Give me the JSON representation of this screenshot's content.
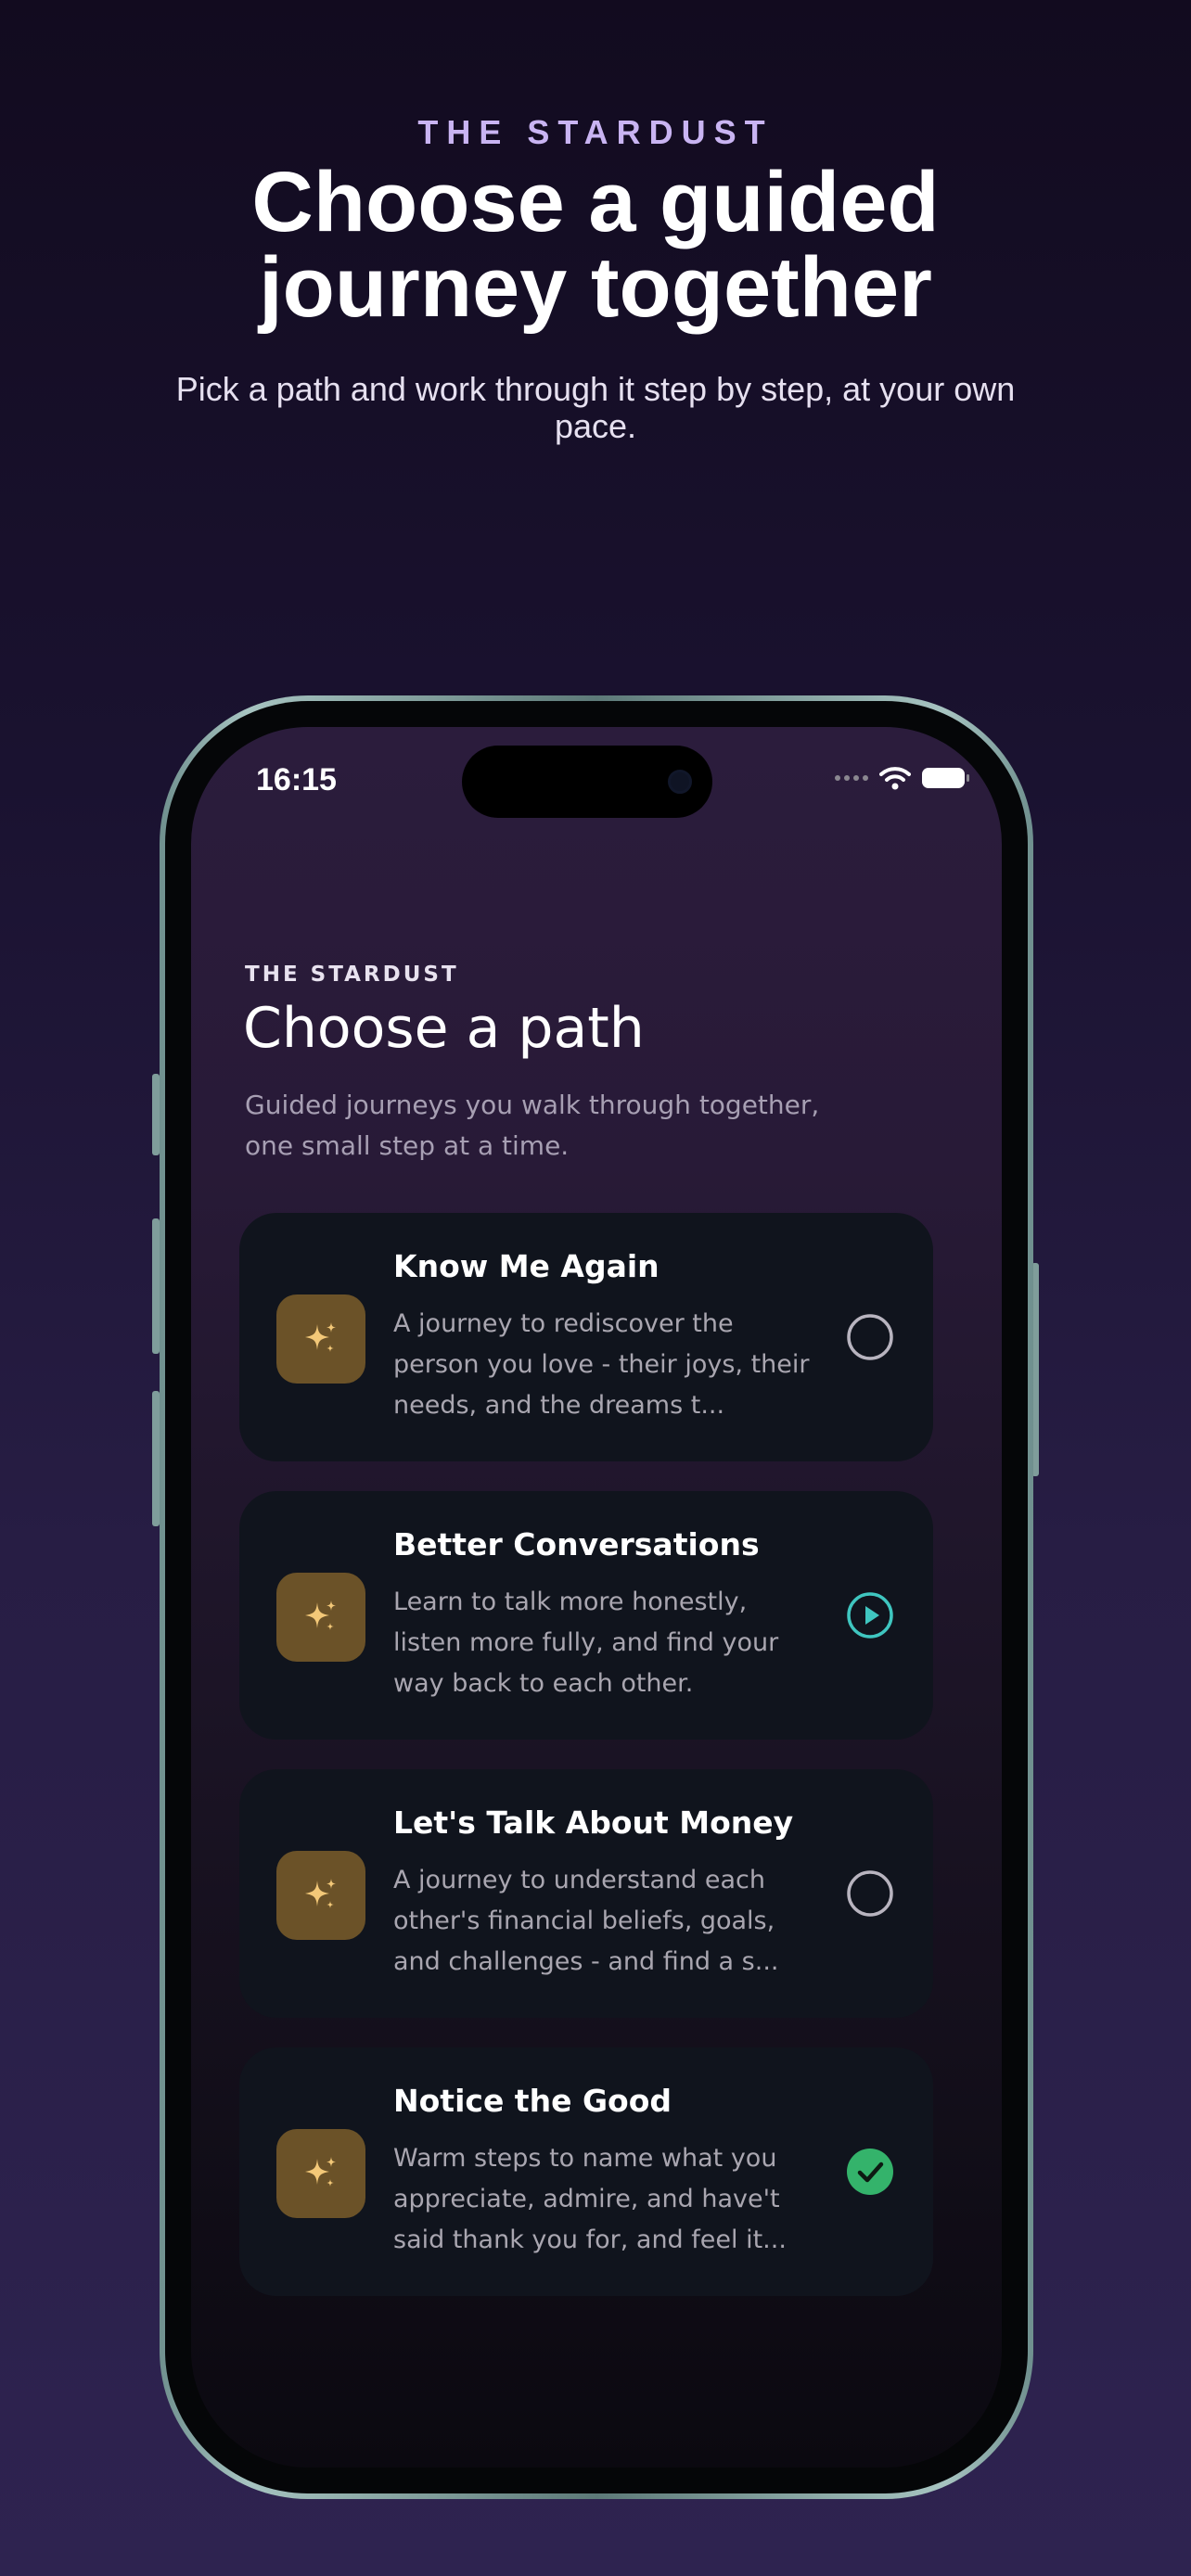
{
  "hero": {
    "eyebrow": "THE STARDUST",
    "title": "Choose a guided journey together",
    "subtitle": "Pick a path and work through it step by step, at your own pace."
  },
  "status_bar": {
    "time": "16:15"
  },
  "screen": {
    "eyebrow": "THE STARDUST",
    "title": "Choose a path",
    "subtitle": "Guided journeys you walk through together, one small step at a time."
  },
  "paths": [
    {
      "title": "Know Me Again",
      "description": "A journey to rediscover the person you love - their joys, their needs, and the dreams t...",
      "icon": "sparkle-icon",
      "state": "not-started"
    },
    {
      "title": "Better Conversations",
      "description": "Learn to talk more honestly, listen more fully, and find your way back to each other.",
      "icon": "sparkle-icon",
      "state": "in-progress"
    },
    {
      "title": "Let's Talk About Money",
      "description": "A journey to understand each other's financial beliefs, goals, and challenges - and find a s...",
      "icon": "sparkle-icon",
      "state": "not-started"
    },
    {
      "title": "Notice the Good",
      "description": "Warm steps to name what you appreciate, admire, and have't said thank you for, and feel it...",
      "icon": "sparkle-icon",
      "state": "completed"
    }
  ],
  "colors": {
    "accent_progress": "#3fc6c0",
    "accent_completed": "#34b36b",
    "icon_tile": "#6b5228",
    "icon_glyph": "#f3c878",
    "card_background": "#10141d"
  }
}
